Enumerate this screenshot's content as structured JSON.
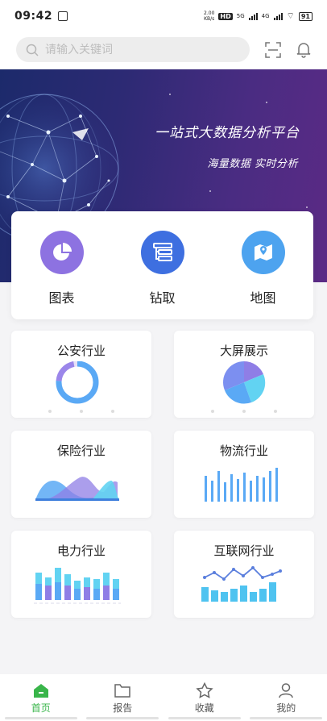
{
  "status_bar": {
    "time": "09:42",
    "net_speed": "2.00\nKB/s",
    "hd_badge": "HD",
    "sig1": "5G",
    "sig2": "4G",
    "battery": "91"
  },
  "search": {
    "placeholder": "请输入关键词"
  },
  "banner": {
    "title": "一站式大数据分析平台",
    "subtitle": "海量数据 实时分析"
  },
  "quick_actions": [
    {
      "label": "图表",
      "icon": "pie-chart-icon",
      "color": "#8d72e1"
    },
    {
      "label": "钻取",
      "icon": "drill-icon",
      "color": "#3e6fe0"
    },
    {
      "label": "地图",
      "icon": "map-icon",
      "color": "#4da3ef"
    }
  ],
  "industries": [
    {
      "title": "公安行业"
    },
    {
      "title": "大屏展示"
    },
    {
      "title": "保险行业"
    },
    {
      "title": "物流行业"
    },
    {
      "title": "电力行业"
    },
    {
      "title": "互联网行业"
    }
  ],
  "tabs": [
    {
      "label": "首页",
      "icon": "home-icon",
      "active": true
    },
    {
      "label": "报告",
      "icon": "folder-icon",
      "active": false
    },
    {
      "label": "收藏",
      "icon": "star-icon",
      "active": false
    },
    {
      "label": "我的",
      "icon": "user-icon",
      "active": false
    }
  ],
  "colors": {
    "accent_green": "#39b54a",
    "chart_blue": "#5aa9f5",
    "chart_purple": "#8f7ee6",
    "chart_cyan": "#62d3f2"
  }
}
